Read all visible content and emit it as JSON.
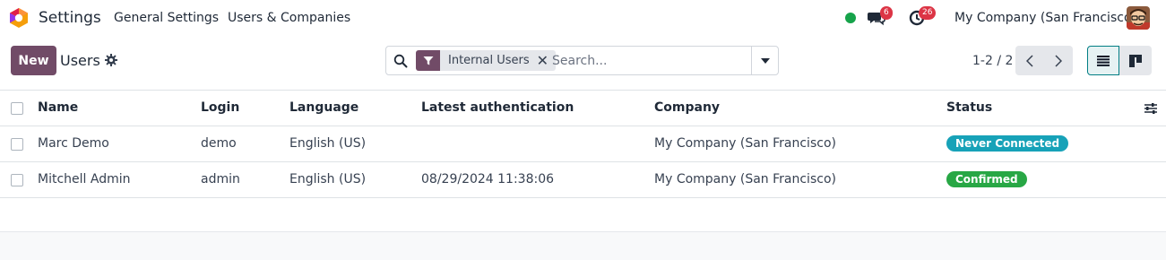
{
  "navbar": {
    "app_name": "Settings",
    "menu": [
      "General Settings",
      "Users & Companies"
    ],
    "messages_badge": "6",
    "activities_badge": "26",
    "company": "My Company (San Francisco)",
    "status_color": "#16a34a"
  },
  "control_panel": {
    "new_label": "New",
    "breadcrumb": "Users",
    "search": {
      "facet_label": "Internal Users",
      "placeholder": "Search..."
    },
    "pager": "1-2 / 2"
  },
  "table": {
    "columns": [
      "Name",
      "Login",
      "Language",
      "Latest authentication",
      "Company",
      "Status"
    ],
    "rows": [
      {
        "name": "Marc Demo",
        "login": "demo",
        "language": "English (US)",
        "latest_auth": "",
        "company": "My Company (San Francisco)",
        "status": "Never Connected",
        "status_color": "#17a2b8"
      },
      {
        "name": "Mitchell Admin",
        "login": "admin",
        "language": "English (US)",
        "latest_auth": "08/29/2024 11:38:06",
        "company": "My Company (San Francisco)",
        "status": "Confirmed",
        "status_color": "#28a745"
      }
    ]
  },
  "colors": {
    "brand": "#714b67",
    "accent": "#017e84"
  }
}
